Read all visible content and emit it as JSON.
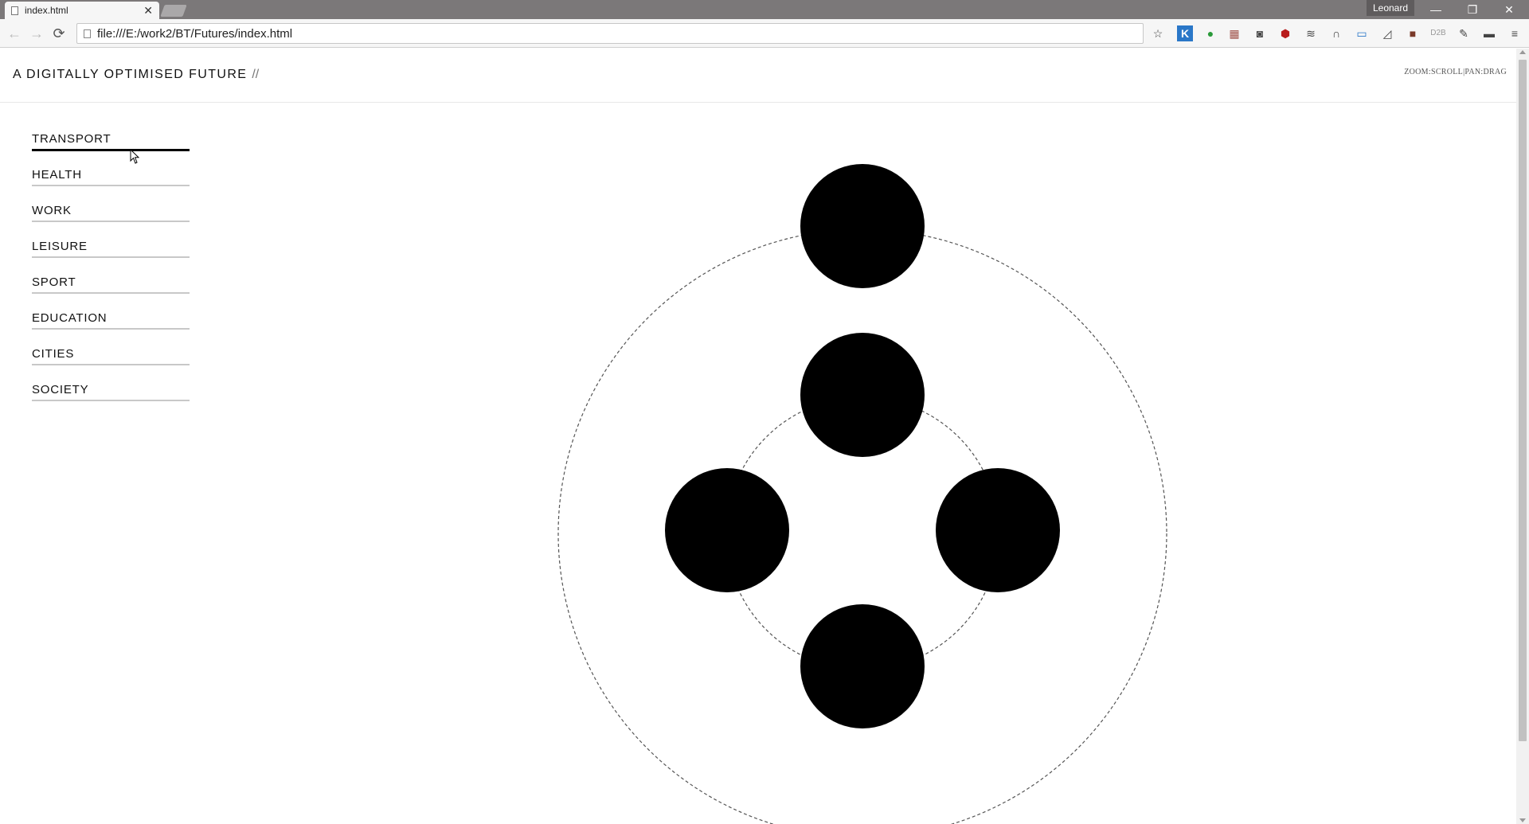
{
  "browser": {
    "tab_title": "index.html",
    "tab_close": "✕",
    "profile_name": "Leonard",
    "url": "file:///E:/work2/BT/Futures/index.html",
    "window_controls": [
      "—",
      "❐",
      "✕"
    ],
    "extensions": [
      "star-icon",
      "k-icon",
      "green-badge-icon",
      "calendar-icon",
      "camera-icon",
      "ublock-icon",
      "layers-icon",
      "headphones-icon",
      "screen-icon",
      "cast-icon",
      "avatar-icon",
      "d2b-icon",
      "pen-icon",
      "chat-icon",
      "menu-icon"
    ],
    "d2b_label": "D2B"
  },
  "site": {
    "title": "A Digitally Optimised Future",
    "title_sep": "//",
    "hint": "ZOOM:SCROLL|PAN:DRAG"
  },
  "menu": {
    "items": [
      {
        "label": "TRANSPORT",
        "active": true
      },
      {
        "label": "HEALTH",
        "active": false
      },
      {
        "label": "WORK",
        "active": false
      },
      {
        "label": "LEISURE",
        "active": false
      },
      {
        "label": "SPORT",
        "active": false
      },
      {
        "label": "EDUCATION",
        "active": false
      },
      {
        "label": "CITIES",
        "active": false
      },
      {
        "label": "SOCIETY",
        "active": false
      }
    ]
  },
  "colors": {
    "node": "#000000",
    "orbit": "#555555",
    "active_line": "#000000",
    "inactive_line": "#c8c8c8"
  }
}
